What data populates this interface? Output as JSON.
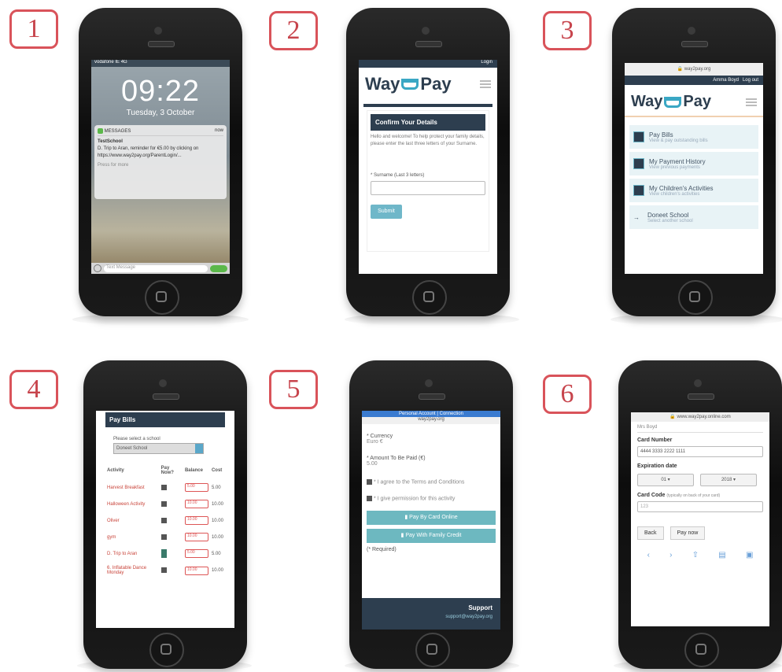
{
  "steps": [
    "1",
    "2",
    "3",
    "4",
    "5",
    "6"
  ],
  "phone1": {
    "status": "vodafone IE   4G",
    "time": "09:22",
    "date": "Tuesday, 3 October",
    "app": "MESSAGES",
    "when": "now",
    "sender": "TestSchool",
    "message": "D. Trip to Aran, reminder for €5.00 by clicking on https://www.way2pay.org/ParentLogin/...",
    "more": "Press for more",
    "placeholder": "Text Message"
  },
  "phone2": {
    "login": "Login",
    "logo_a": "Way",
    "logo_b": "Pay",
    "header": "Confirm Your Details",
    "intro": "Hello and welcome! To help protect your family details, please enter the last three letters of your Surname.",
    "label": "* Surname (Last 3 letters)",
    "submit": "Submit"
  },
  "phone3": {
    "url": "way2pay.org",
    "nav_user": "Amma Boyd",
    "nav_logout": "Log out",
    "logo_a": "Way",
    "logo_b": "Pay",
    "menu": [
      {
        "label": "Pay Bills",
        "sub": "View & pay outstanding bills"
      },
      {
        "label": "My Payment History",
        "sub": "View previous payments"
      },
      {
        "label": "My Children's Activities",
        "sub": "View children's activities"
      },
      {
        "label": "Doneet School",
        "sub": "Select another school"
      }
    ]
  },
  "phone4": {
    "title": "Pay Bills",
    "select_label": "Please select a school",
    "select_value": "Doneet School",
    "columns": [
      "Activity",
      "Pay Now?",
      "Balance",
      "Cost"
    ],
    "rows": [
      {
        "activity": "Harvest Breakfast",
        "amount": "5.00",
        "cost": "5.00"
      },
      {
        "activity": "Halloween Activity",
        "amount": "10.00",
        "cost": "10.00"
      },
      {
        "activity": "Oliver",
        "amount": "10.00",
        "cost": "10.00"
      },
      {
        "activity": "gym",
        "amount": "10.00",
        "cost": "10.00"
      },
      {
        "activity": "D. Trip to Aran",
        "amount": "5.00",
        "cost": "5.00"
      },
      {
        "activity": "6. Inflatable Dance Monday",
        "amount": "10.00",
        "cost": "10.00"
      }
    ]
  },
  "phone5": {
    "header": "Personal Account | Connection",
    "url": "way2pay.org",
    "currency_label": "* Currency",
    "currency_value": "Euro €",
    "amount_label": "* Amount To Be Paid (€)",
    "amount_value": "5.00",
    "agree": "* I agree to the Terms and Conditions",
    "permission": "* I give permission for this activity",
    "pay_card": "Pay By Card Online",
    "pay_family": "Pay With Family Credit",
    "required": "(* Required)",
    "support": "Support",
    "support_link": "support@way2pay.org"
  },
  "phone6": {
    "url": "www.way2pay.online.com",
    "name": "Mrs Boyd",
    "card_label": "Card Number",
    "card_value": "4444 3333 2222 1111",
    "exp_label": "Expiration date",
    "exp_month": "01",
    "exp_year": "2018",
    "code_label": "Card Code",
    "code_hint": "(typically on back of your card)",
    "code_value": "123",
    "back": "Back",
    "pay": "Pay now"
  }
}
